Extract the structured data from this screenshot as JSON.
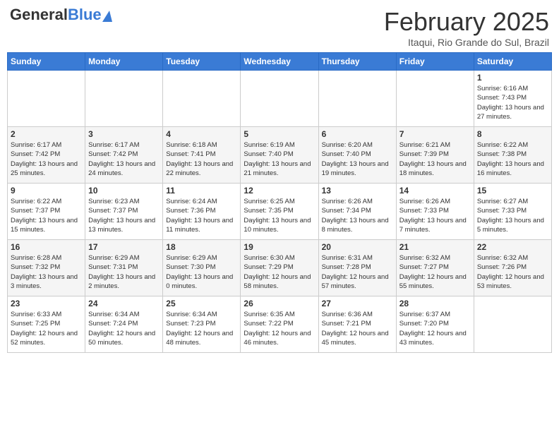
{
  "header": {
    "logo_general": "General",
    "logo_blue": "Blue",
    "month_title": "February 2025",
    "location": "Itaqui, Rio Grande do Sul, Brazil"
  },
  "weekdays": [
    "Sunday",
    "Monday",
    "Tuesday",
    "Wednesday",
    "Thursday",
    "Friday",
    "Saturday"
  ],
  "weeks": [
    [
      {
        "day": "",
        "info": ""
      },
      {
        "day": "",
        "info": ""
      },
      {
        "day": "",
        "info": ""
      },
      {
        "day": "",
        "info": ""
      },
      {
        "day": "",
        "info": ""
      },
      {
        "day": "",
        "info": ""
      },
      {
        "day": "1",
        "info": "Sunrise: 6:16 AM\nSunset: 7:43 PM\nDaylight: 13 hours and 27 minutes."
      }
    ],
    [
      {
        "day": "2",
        "info": "Sunrise: 6:17 AM\nSunset: 7:42 PM\nDaylight: 13 hours and 25 minutes."
      },
      {
        "day": "3",
        "info": "Sunrise: 6:17 AM\nSunset: 7:42 PM\nDaylight: 13 hours and 24 minutes."
      },
      {
        "day": "4",
        "info": "Sunrise: 6:18 AM\nSunset: 7:41 PM\nDaylight: 13 hours and 22 minutes."
      },
      {
        "day": "5",
        "info": "Sunrise: 6:19 AM\nSunset: 7:40 PM\nDaylight: 13 hours and 21 minutes."
      },
      {
        "day": "6",
        "info": "Sunrise: 6:20 AM\nSunset: 7:40 PM\nDaylight: 13 hours and 19 minutes."
      },
      {
        "day": "7",
        "info": "Sunrise: 6:21 AM\nSunset: 7:39 PM\nDaylight: 13 hours and 18 minutes."
      },
      {
        "day": "8",
        "info": "Sunrise: 6:22 AM\nSunset: 7:38 PM\nDaylight: 13 hours and 16 minutes."
      }
    ],
    [
      {
        "day": "9",
        "info": "Sunrise: 6:22 AM\nSunset: 7:37 PM\nDaylight: 13 hours and 15 minutes."
      },
      {
        "day": "10",
        "info": "Sunrise: 6:23 AM\nSunset: 7:37 PM\nDaylight: 13 hours and 13 minutes."
      },
      {
        "day": "11",
        "info": "Sunrise: 6:24 AM\nSunset: 7:36 PM\nDaylight: 13 hours and 11 minutes."
      },
      {
        "day": "12",
        "info": "Sunrise: 6:25 AM\nSunset: 7:35 PM\nDaylight: 13 hours and 10 minutes."
      },
      {
        "day": "13",
        "info": "Sunrise: 6:26 AM\nSunset: 7:34 PM\nDaylight: 13 hours and 8 minutes."
      },
      {
        "day": "14",
        "info": "Sunrise: 6:26 AM\nSunset: 7:33 PM\nDaylight: 13 hours and 7 minutes."
      },
      {
        "day": "15",
        "info": "Sunrise: 6:27 AM\nSunset: 7:33 PM\nDaylight: 13 hours and 5 minutes."
      }
    ],
    [
      {
        "day": "16",
        "info": "Sunrise: 6:28 AM\nSunset: 7:32 PM\nDaylight: 13 hours and 3 minutes."
      },
      {
        "day": "17",
        "info": "Sunrise: 6:29 AM\nSunset: 7:31 PM\nDaylight: 13 hours and 2 minutes."
      },
      {
        "day": "18",
        "info": "Sunrise: 6:29 AM\nSunset: 7:30 PM\nDaylight: 13 hours and 0 minutes."
      },
      {
        "day": "19",
        "info": "Sunrise: 6:30 AM\nSunset: 7:29 PM\nDaylight: 12 hours and 58 minutes."
      },
      {
        "day": "20",
        "info": "Sunrise: 6:31 AM\nSunset: 7:28 PM\nDaylight: 12 hours and 57 minutes."
      },
      {
        "day": "21",
        "info": "Sunrise: 6:32 AM\nSunset: 7:27 PM\nDaylight: 12 hours and 55 minutes."
      },
      {
        "day": "22",
        "info": "Sunrise: 6:32 AM\nSunset: 7:26 PM\nDaylight: 12 hours and 53 minutes."
      }
    ],
    [
      {
        "day": "23",
        "info": "Sunrise: 6:33 AM\nSunset: 7:25 PM\nDaylight: 12 hours and 52 minutes."
      },
      {
        "day": "24",
        "info": "Sunrise: 6:34 AM\nSunset: 7:24 PM\nDaylight: 12 hours and 50 minutes."
      },
      {
        "day": "25",
        "info": "Sunrise: 6:34 AM\nSunset: 7:23 PM\nDaylight: 12 hours and 48 minutes."
      },
      {
        "day": "26",
        "info": "Sunrise: 6:35 AM\nSunset: 7:22 PM\nDaylight: 12 hours and 46 minutes."
      },
      {
        "day": "27",
        "info": "Sunrise: 6:36 AM\nSunset: 7:21 PM\nDaylight: 12 hours and 45 minutes."
      },
      {
        "day": "28",
        "info": "Sunrise: 6:37 AM\nSunset: 7:20 PM\nDaylight: 12 hours and 43 minutes."
      },
      {
        "day": "",
        "info": ""
      }
    ]
  ]
}
